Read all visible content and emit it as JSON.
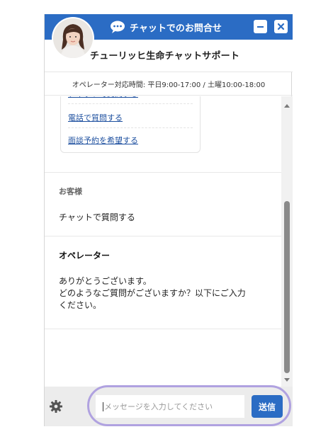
{
  "header": {
    "title": "チャットでのお問合せ",
    "minimize_icon": "minimize-icon",
    "close_icon": "close-icon",
    "brand_color": "#2b6cc4"
  },
  "subheader": {
    "company_name": "チューリッヒ生命チャットサポート"
  },
  "hours": {
    "text": "オペレーター対応時間: 平日9:00-17:00 / 土曜10:00-18:00"
  },
  "options": {
    "items": [
      {
        "label": "チャットで質問する"
      },
      {
        "label": "電話で質問する"
      },
      {
        "label": "面談予約を希望する"
      }
    ]
  },
  "messages": [
    {
      "sender": "お客様",
      "text": "チャットで質問する"
    },
    {
      "sender": "オペレーター",
      "lines": [
        "ありがとうございます。",
        "どのようなご質問がございますか？以下にご入力",
        "ください。"
      ]
    }
  ],
  "footer": {
    "input_placeholder": "メッセージを入力してください",
    "send_label": "送信",
    "settings_icon": "gear-icon"
  }
}
